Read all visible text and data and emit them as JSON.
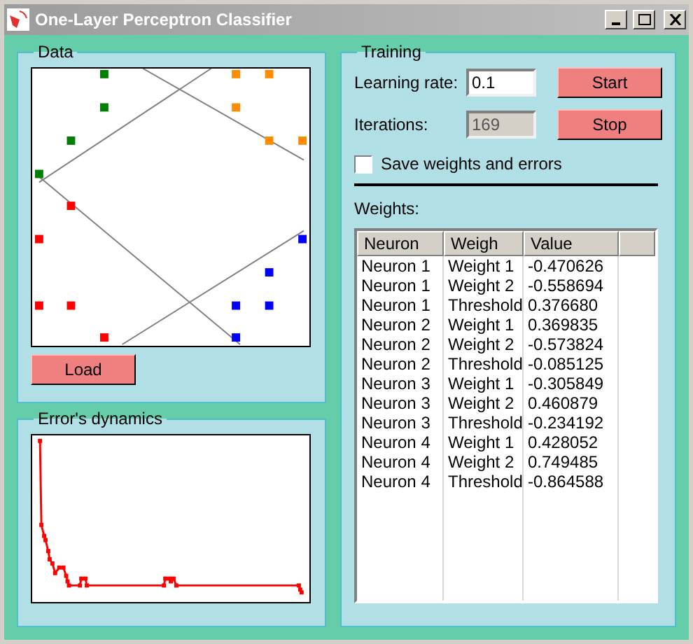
{
  "window": {
    "title": "One-Layer Perceptron Classifier"
  },
  "data_group": {
    "title": "Data",
    "load_button": "Load"
  },
  "error_group": {
    "title": "Error's dynamics"
  },
  "training": {
    "title": "Training",
    "learning_rate": {
      "label": "Learning rate:",
      "value": "0.1",
      "disabled": false
    },
    "iterations": {
      "label": "Iterations:",
      "value": "169",
      "disabled": true
    },
    "start_button": "Start",
    "stop_button": "Stop",
    "save_checkbox": {
      "label": "Save weights and errors",
      "checked": false
    },
    "weights": {
      "label": "Weights:",
      "columns": [
        "Neuron",
        "Weigh",
        "Value"
      ],
      "rows": [
        [
          "Neuron 1",
          "Weight 1",
          "-0.470626"
        ],
        [
          "Neuron 1",
          "Weight 2",
          "-0.558694"
        ],
        [
          "Neuron 1",
          "Threshold",
          "0.376680"
        ],
        [
          "Neuron 2",
          "Weight 1",
          "0.369835"
        ],
        [
          "Neuron 2",
          "Weight 2",
          "-0.573824"
        ],
        [
          "Neuron 2",
          "Threshold",
          "-0.085125"
        ],
        [
          "Neuron 3",
          "Weight 1",
          "-0.305849"
        ],
        [
          "Neuron 3",
          "Weight 2",
          "0.460879"
        ],
        [
          "Neuron 3",
          "Threshold",
          "-0.234192"
        ],
        [
          "Neuron 4",
          "Weight 1",
          "0.428052"
        ],
        [
          "Neuron 4",
          "Weight 2",
          "0.749485"
        ],
        [
          "Neuron 4",
          "Threshold",
          "-0.864588"
        ]
      ]
    }
  }
}
